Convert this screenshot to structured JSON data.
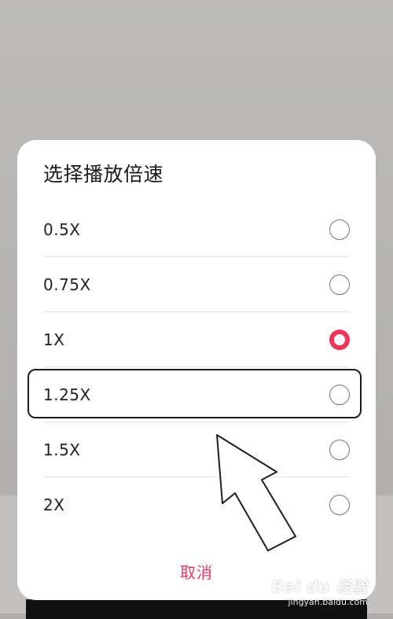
{
  "dialog": {
    "title": "选择播放倍速",
    "options": [
      {
        "label": "0.5X",
        "selected": false
      },
      {
        "label": "0.75X",
        "selected": false
      },
      {
        "label": "1X",
        "selected": true
      },
      {
        "label": "1.25X",
        "selected": false
      },
      {
        "label": "1.5X",
        "selected": false
      },
      {
        "label": "2X",
        "selected": false
      }
    ],
    "cancel_label": "取消"
  },
  "colors": {
    "accent": "#e8365e",
    "overlay": "#b7b6b4",
    "sheet": "#ffffff"
  },
  "annotation": {
    "highlighted_option": "1.25X",
    "pointer": "arrow-pointer-icon"
  },
  "watermark": {
    "logo": "Bai du 经验",
    "url": "jingyan.baidu.com"
  }
}
